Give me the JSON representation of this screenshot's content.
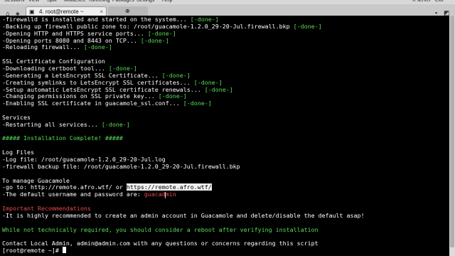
{
  "menubar": {
    "items": [
      "Sessions",
      "View",
      "Split",
      "MultiExec",
      "Tunneling",
      "Packages",
      "Settings",
      "Help",
      "X server",
      "Exit"
    ]
  },
  "tabs": [
    {
      "icon": "terminal-icon",
      "label": "4. root@remote ~",
      "close": "×"
    },
    {
      "icon": "new-tab-icon",
      "label": "",
      "close": ""
    }
  ],
  "terminal": {
    "lines": [
      {
        "text": "-firewalld is installed and started on the system... ",
        "tail": "[-done-]",
        "style": ""
      },
      {
        "text": "-Backing up firewall public zone to: /root/guacamole-1.2.0_29-20-Jul.firewall.bkp ",
        "tail": "[-done-]",
        "style": ""
      },
      {
        "text": "-Opening HTTP and HTTPS service ports... ",
        "tail": "[-done-]",
        "style": ""
      },
      {
        "text": "-Opening ports 8080 and 8443 on TCP... ",
        "tail": "[-done-]",
        "style": ""
      },
      {
        "text": "-Reloading firewall... ",
        "tail": "[-done-]",
        "style": ""
      },
      {
        "text": "",
        "tail": "",
        "style": ""
      },
      {
        "text": "SSL Certificate Configuration",
        "tail": "",
        "style": ""
      },
      {
        "text": "-Downloading certboot tool... ",
        "tail": "[-done-]",
        "style": ""
      },
      {
        "text": "-Generating a LetsEncrypt SSL Certificate... ",
        "tail": "[-done-]",
        "style": ""
      },
      {
        "text": "-Creating symlinks to LetsEncrypt SSL certificates... ",
        "tail": "[-done-]",
        "style": ""
      },
      {
        "text": "-Setup automatic LetsEncrypt SSL certificate renewals... ",
        "tail": "[-done-]",
        "style": ""
      },
      {
        "text": "-Changing permissions on SSL private key... ",
        "tail": "[-done-]",
        "style": ""
      },
      {
        "text": "-Enabling SSL certificate in guacamole_ssl.conf... ",
        "tail": "[-done-]",
        "style": ""
      },
      {
        "text": "",
        "tail": "",
        "style": ""
      },
      {
        "text": "Services",
        "tail": "",
        "style": ""
      },
      {
        "text": "-Restarting all services... ",
        "tail": "[-done-]",
        "style": ""
      },
      {
        "text": "",
        "tail": "",
        "style": ""
      },
      {
        "text": "##### Installation Complete! #####",
        "tail": "",
        "style": "g"
      },
      {
        "text": "",
        "tail": "",
        "style": ""
      },
      {
        "text": "Log Files",
        "tail": "",
        "style": ""
      },
      {
        "text": "-Log file: /root/guacamole-1.2.0_29-20-Jul.log",
        "tail": "",
        "style": ""
      },
      {
        "text": "-firewall backup file: /root/guacamole-1.2.0_29-20-Jul.firewall.bkp",
        "tail": "",
        "style": ""
      },
      {
        "text": "",
        "tail": "",
        "style": ""
      },
      {
        "text": "To manage Guacamole",
        "tail": "",
        "style": ""
      },
      {
        "text": "-go to: http://remote.afro.wtf/ or ",
        "tail": "",
        "style": "",
        "highlight": "https://remote.afro.wtf/"
      },
      {
        "text": "-The default username and password are: ",
        "tail": "guacadmin",
        "style": "",
        "tail_style": "r"
      },
      {
        "text": "",
        "tail": "",
        "style": ""
      },
      {
        "text": "Important Recommendations",
        "tail": "",
        "style": "r"
      },
      {
        "text": "-It is highly recommended to create an admin account in Guacamole and delete/disable the default asap!",
        "tail": "",
        "style": ""
      },
      {
        "text": "",
        "tail": "",
        "style": ""
      },
      {
        "text": "While not technically required, you should consider a reboot after verifying installation",
        "tail": "",
        "style": "g"
      },
      {
        "text": "",
        "tail": "",
        "style": ""
      },
      {
        "text": "Contact Local Admin, admin@admin.com with any questions or concerns regarding this script",
        "tail": "",
        "style": ""
      }
    ],
    "prompt": "[root@remote ~]# "
  },
  "colors": {
    "done": "#55e055",
    "error": "#e84a4a",
    "background": "#000000",
    "text": "#ffffff"
  }
}
